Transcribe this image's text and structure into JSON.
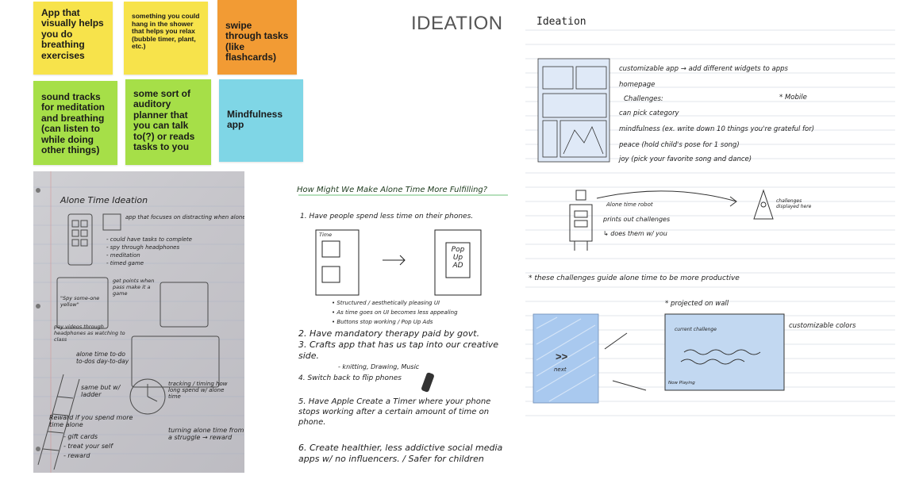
{
  "sticky_notes": [
    {
      "text": "App that visually helps you do breathing exercises"
    },
    {
      "text": "something you could hang in the shower that helps you relax (bubble timer, plant, etc.)"
    },
    {
      "text": "swipe through tasks (like flashcards)"
    },
    {
      "text": "sound tracks for meditation and breathing (can listen to while doing other things)"
    },
    {
      "text": "some sort of auditory planner that you can talk to(?) or reads tasks to you"
    },
    {
      "text": "Mindfulness app"
    }
  ],
  "heading": "IDEATION",
  "sketch_left": {
    "title": "Alone Time Ideation",
    "notes": [
      "app that focuses on distracting when alone",
      "- could have tasks to complete",
      "- spy through headphones",
      "- meditation",
      "- timed game",
      "get points when pass make it a game",
      "\"Spy some-one yellow\"",
      "pay videos through headphones as watching to class",
      "alone time to-do to-dos day-to-day",
      "same but w/ ladder",
      "tracking / timing how long spend w/ alone time",
      "Reward if you spend more time alone",
      "- gift cards",
      "- treat your self",
      "- reward",
      "turning alone time from a struggle → reward"
    ]
  },
  "sketch_middle": {
    "title": "How Might We Make Alone Time More Fulfilling?",
    "item1": "1. Have people spend less time on their phones.",
    "frame_left_label": "Time",
    "frame_right_label": "Pop Up AD",
    "bullets": [
      "• Structured / aesthetically pleasing UI",
      "• As time goes on UI becomes less appealing",
      "• Buttons stop working / Pop Up Ads"
    ],
    "item2": "2. Have mandatory therapy paid by govt.",
    "item3": "3. Crafts app that has us tap into our creative side.",
    "item3_sub": "- knitting, Drawing, Music",
    "item4": "4. Switch back to flip phones",
    "item5": "5. Have Apple Create a Timer where your phone stops working after a certain amount of time on phone.",
    "item6": "6. Create healthier, less addictive social media apps w/ no influencers. / Safer for children"
  },
  "sketch_right": {
    "title": "Ideation",
    "lines": [
      "customizable app → add different widgets to apps",
      "homepage",
      "Challenges:",
      "* Mobile",
      "can pick category",
      "mindfulness (ex. write down 10 things you're grateful for)",
      "peace (hold child's pose for 1 song)",
      "joy (pick your favorite song and dance)"
    ],
    "robot_labels": [
      "Alone time robot",
      "prints out challenges",
      "↳ does them w/ you"
    ],
    "robot2_label": "challenges displayed here",
    "star_line": "* these challenges guide alone time to be more productive",
    "projected": "* projected on wall",
    "projection_box": "current challenge",
    "projection_bottom": "Now Playing",
    "next_label": "next",
    "colors_note": "customizable colors"
  },
  "colors": {
    "yellow": "#f7e34b",
    "orange": "#f29b34",
    "green": "#a6df48",
    "cyan": "#7fd6e6",
    "blue_scribble": "#9fc4ea"
  }
}
